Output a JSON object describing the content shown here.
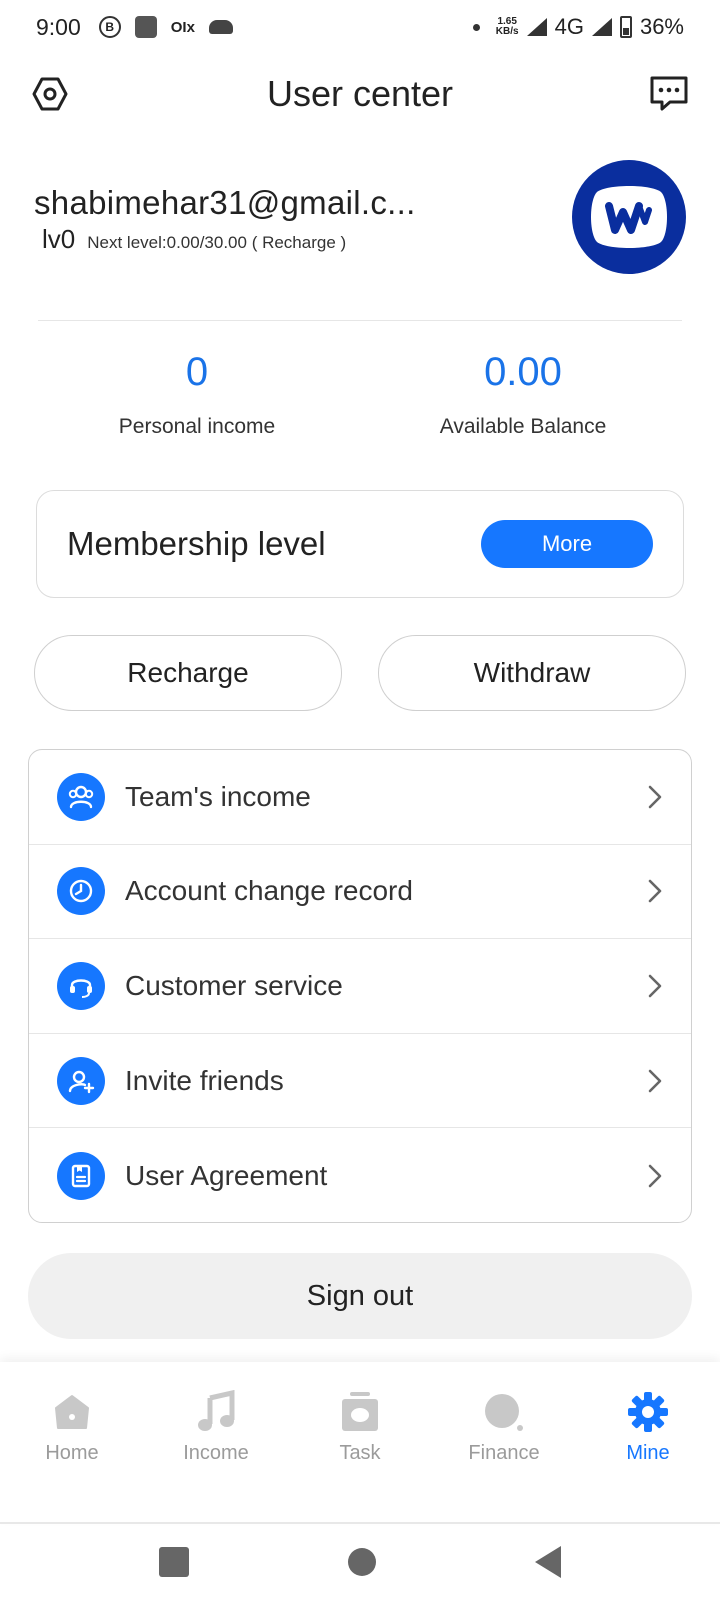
{
  "status_bar": {
    "time": "9:00",
    "notification_icons": [
      "b-circle-icon",
      "square-app-icon",
      "olx-icon",
      "cloud-icon"
    ],
    "speed_value": "1.65",
    "speed_unit": "KB/s",
    "network": "4G",
    "battery": "36%"
  },
  "header": {
    "title": "User center",
    "left_icon": "settings-hexagon-icon",
    "right_icon": "message-icon"
  },
  "profile": {
    "email": "shabimehar31@gmail.c...",
    "level": "lv0",
    "next_level": "Next level:0.00/30.00 ( Recharge )",
    "avatar_icon": "brand-logo-icon",
    "avatar_color": "#0a2e9e"
  },
  "stats": {
    "personal_income_value": "0",
    "personal_income_label": "Personal income",
    "available_balance_value": "0.00",
    "available_balance_label": "Available Balance"
  },
  "membership": {
    "label": "Membership level",
    "button": "More"
  },
  "actions": {
    "recharge": "Recharge",
    "withdraw": "Withdraw"
  },
  "menu": [
    {
      "label": "Team's income",
      "icon": "team-icon"
    },
    {
      "label": "Account change record",
      "icon": "clock-record-icon"
    },
    {
      "label": "Customer service",
      "icon": "headset-icon"
    },
    {
      "label": "Invite friends",
      "icon": "invite-user-icon"
    },
    {
      "label": "User Agreement",
      "icon": "document-icon"
    }
  ],
  "sign_out": "Sign out",
  "tabs": [
    {
      "label": "Home",
      "icon": "home-icon",
      "active": false
    },
    {
      "label": "Income",
      "icon": "music-note-icon",
      "active": false
    },
    {
      "label": "Task",
      "icon": "task-icon",
      "active": false
    },
    {
      "label": "Finance",
      "icon": "finance-icon",
      "active": false
    },
    {
      "label": "Mine",
      "icon": "gear-icon",
      "active": true
    }
  ],
  "colors": {
    "accent": "#1677ff",
    "value_blue": "#1a73e8",
    "inactive_tab": "#9b9b9b"
  }
}
